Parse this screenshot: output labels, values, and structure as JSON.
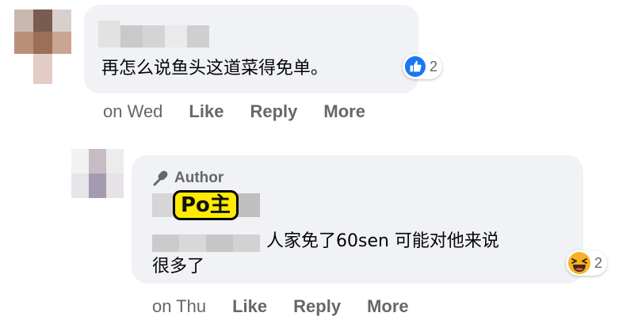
{
  "comment": {
    "text": "再怎么说鱼头这道菜得免单。",
    "reaction": {
      "icon": "like-icon",
      "count": "2"
    },
    "actions": {
      "time": "on Wed",
      "like": "Like",
      "reply": "Reply",
      "more": "More"
    }
  },
  "reply": {
    "author_label": "Author",
    "author_icon": "microphone-icon",
    "badge": "Po主",
    "text_line1": "人家免了60sen 可能对他来说",
    "text_line2": "很多了",
    "reaction": {
      "icon": "haha-icon",
      "count": "2"
    },
    "actions": {
      "time": "on Thu",
      "like": "Like",
      "reply": "Reply",
      "more": "More"
    }
  },
  "colors": {
    "like_blue": "#1877f2",
    "haha_yellow": "#f7b125",
    "badge_yellow": "#ffeb00",
    "bubble_bg": "#f0f2f5",
    "meta_gray": "#65676b"
  }
}
